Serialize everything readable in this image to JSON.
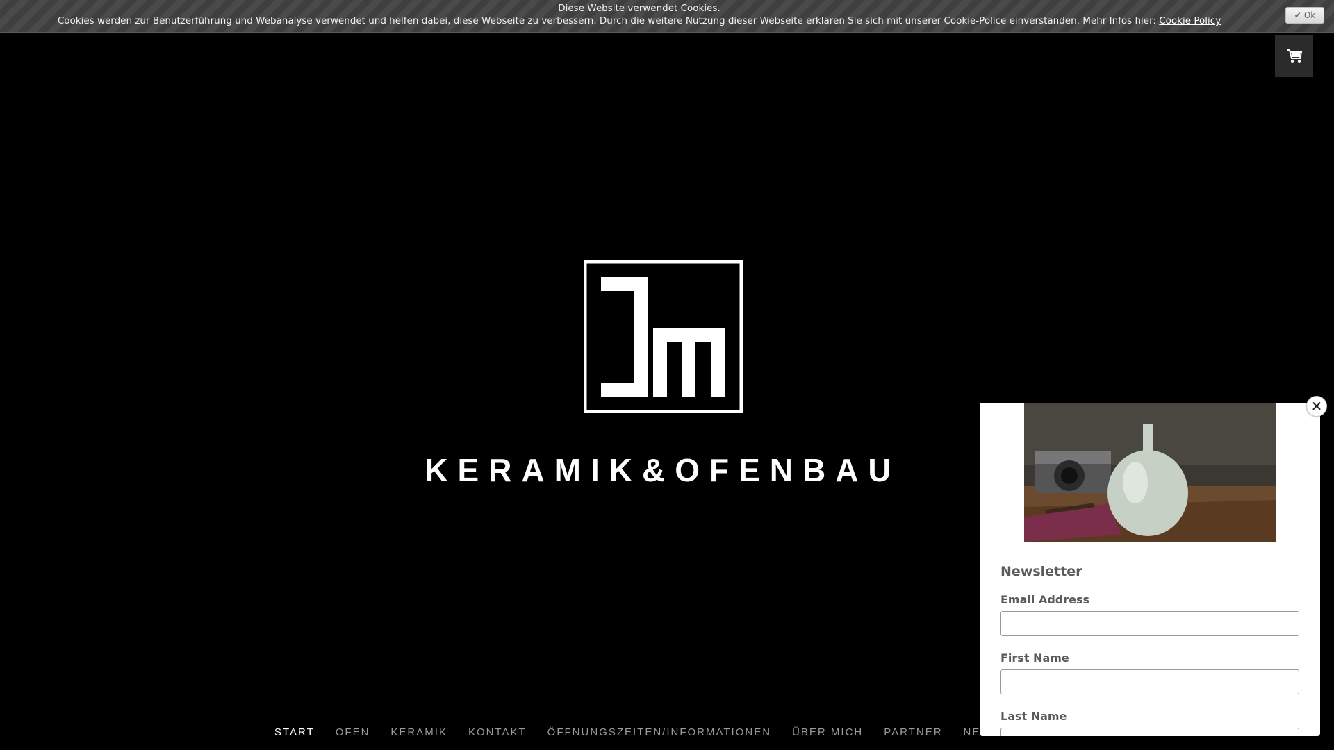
{
  "cookie": {
    "title": "Diese Website verwendet Cookies.",
    "text": "Cookies werden zur Benutzerführung und Webanalyse verwendet und helfen dabei, diese Webseite zu verbessern. Durch die weitere Nutzung dieser Webseite erklären Sie sich mit unserer Cookie-Police einverstanden. Mehr Infos hier:",
    "link": "Cookie Policy",
    "ok_label": "Ok"
  },
  "cart": {
    "icon": "cart-icon"
  },
  "brand": {
    "name": "KERAMIK&OFENBAU",
    "logo": "jm-logo"
  },
  "nav": {
    "items": [
      {
        "label": "START"
      },
      {
        "label": "OFEN"
      },
      {
        "label": "KERAMIK"
      },
      {
        "label": "KONTAKT"
      },
      {
        "label": "ÖFFNUNGSZEITEN/INFORMATIONEN"
      },
      {
        "label": "ÜBER MICH"
      },
      {
        "label": "PARTNER"
      },
      {
        "label": "NEWSLETTER"
      }
    ],
    "active": "START"
  },
  "newsletter": {
    "title": "Newsletter",
    "email_label": "Email Address",
    "email_value": "",
    "first_name_label": "First Name",
    "first_name_value": "",
    "last_name_label": "Last Name",
    "last_name_value": "",
    "close_icon": "close-icon"
  },
  "colors": {
    "background": "#000000",
    "cookie_bar": "#444444",
    "nav_active": "#ffffff",
    "nav_inactive": "#9a9a9a"
  }
}
